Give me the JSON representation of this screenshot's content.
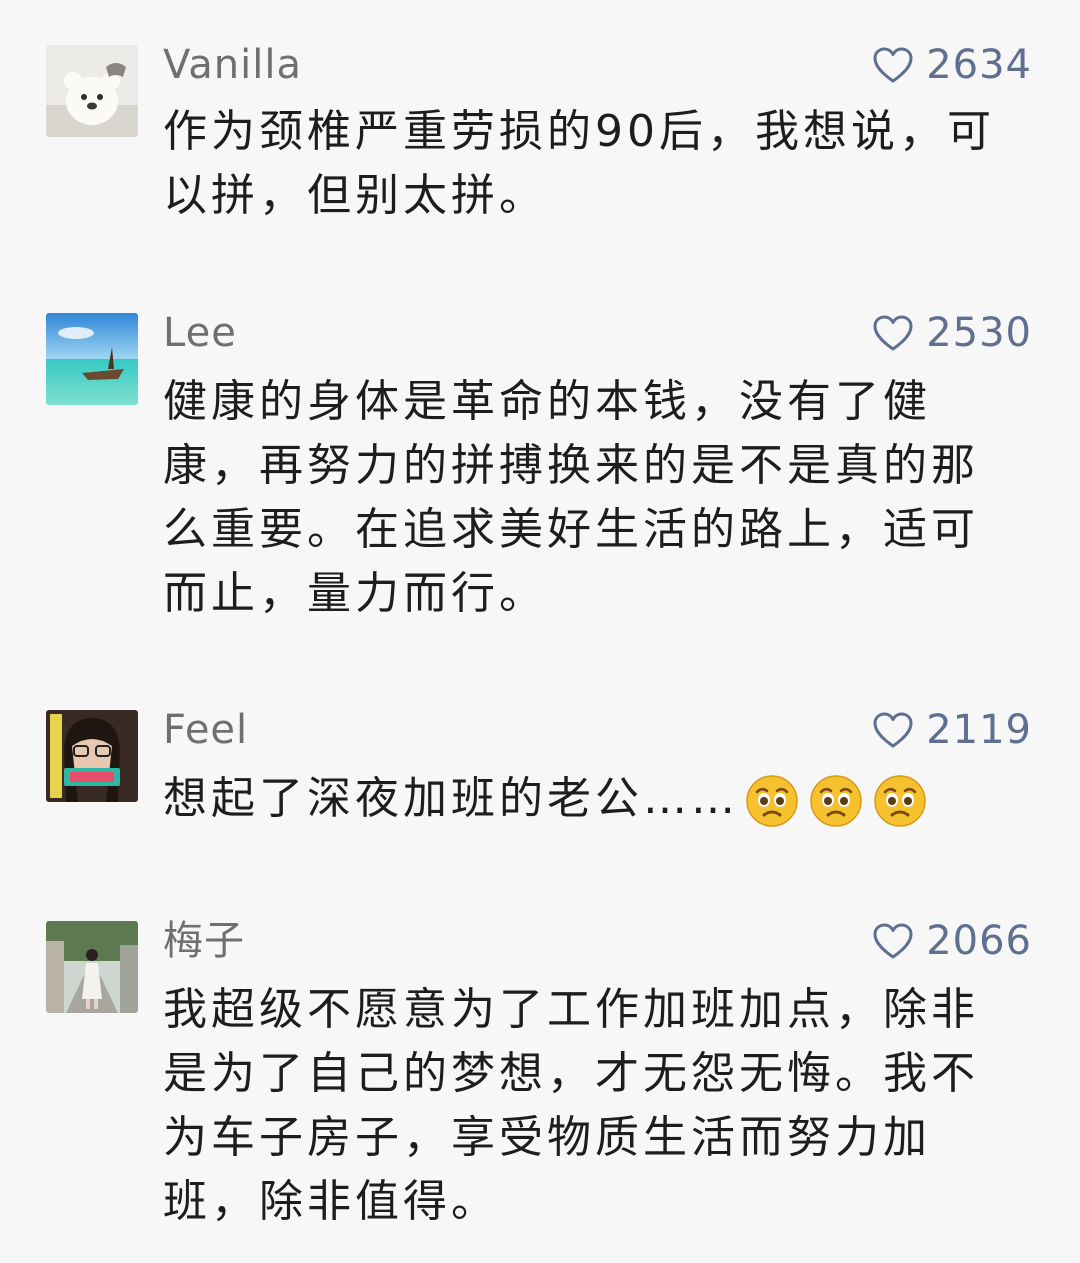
{
  "comments": [
    {
      "user": "Vanilla",
      "likes": "2634",
      "text": "作为颈椎严重劳损的90后，我想说，可以拼，但别太拼。"
    },
    {
      "user": "Lee",
      "likes": "2530",
      "text": "健康的身体是革命的本钱，没有了健康，再努力的拼搏换来的是不是真的那么重要。在追求美好生活的路上，适可而止，量力而行。"
    },
    {
      "user": "Feel",
      "likes": "2119",
      "text": "想起了深夜加班的老公……",
      "emojis": [
        "pleading-face-icon",
        "pleading-face-icon",
        "pleading-face-icon"
      ]
    },
    {
      "user": "梅子",
      "likes": "2066",
      "text": "我超级不愿意为了工作加班加点，除非是为了自己的梦想，才无怨无悔。我不为车子房子，享受物质生活而努力加班，除非值得。"
    }
  ],
  "colors": {
    "background": "#f7f7f7",
    "name": "#6f6f6f",
    "like": "#5e6f8f",
    "text": "#1d1d1d"
  }
}
